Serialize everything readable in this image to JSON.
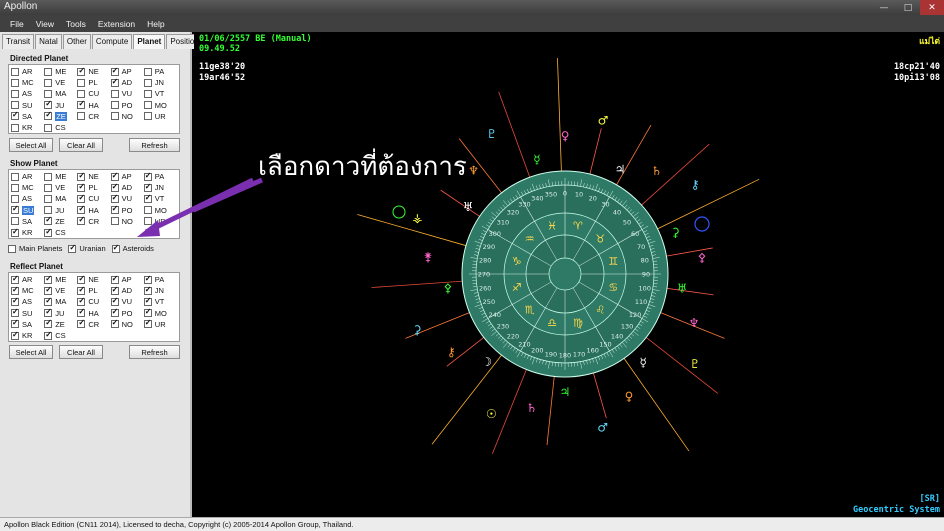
{
  "window": {
    "title": "Apollon",
    "controls": [
      "—",
      "□",
      "✕"
    ]
  },
  "menu": [
    "File",
    "View",
    "Tools",
    "Extension",
    "Help"
  ],
  "tabs": [
    {
      "label": "Transit",
      "active": false
    },
    {
      "label": "Natal",
      "active": false
    },
    {
      "label": "Other",
      "active": false
    },
    {
      "label": "Compute",
      "active": false
    },
    {
      "label": "Planet",
      "active": true
    },
    {
      "label": "Position",
      "active": false
    }
  ],
  "directed": {
    "label": "Directed Planet",
    "items": [
      {
        "code": "AR",
        "on": false
      },
      {
        "code": "ME",
        "on": false
      },
      {
        "code": "NE",
        "on": true
      },
      {
        "code": "AP",
        "on": true
      },
      {
        "code": "PA",
        "on": false
      },
      {
        "code": "MC",
        "on": false
      },
      {
        "code": "VE",
        "on": false
      },
      {
        "code": "PL",
        "on": false
      },
      {
        "code": "AD",
        "on": true
      },
      {
        "code": "JN",
        "on": false
      },
      {
        "code": "AS",
        "on": false
      },
      {
        "code": "MA",
        "on": false
      },
      {
        "code": "CU",
        "on": false
      },
      {
        "code": "VU",
        "on": false
      },
      {
        "code": "VT",
        "on": false
      },
      {
        "code": "SU",
        "on": false
      },
      {
        "code": "JU",
        "on": true
      },
      {
        "code": "HA",
        "on": true
      },
      {
        "code": "PO",
        "on": false
      },
      {
        "code": "MO",
        "on": false
      },
      {
        "code": "SA",
        "on": true
      },
      {
        "code": "ZE",
        "on": true,
        "highlight": true
      },
      {
        "code": "CR",
        "on": false
      },
      {
        "code": "NO",
        "on": false
      },
      {
        "code": "UR",
        "on": false
      },
      {
        "code": "KR",
        "on": false
      },
      {
        "code": "CS",
        "on": false
      }
    ],
    "select_all": "Select All",
    "clear_all": "Clear All",
    "refresh": "Refresh"
  },
  "show": {
    "label": "Show Planet",
    "items": [
      {
        "code": "AR",
        "on": false
      },
      {
        "code": "ME",
        "on": false
      },
      {
        "code": "NE",
        "on": true
      },
      {
        "code": "AP",
        "on": true
      },
      {
        "code": "PA",
        "on": true
      },
      {
        "code": "MC",
        "on": false
      },
      {
        "code": "VE",
        "on": false
      },
      {
        "code": "PL",
        "on": true
      },
      {
        "code": "AD",
        "on": true
      },
      {
        "code": "JN",
        "on": true
      },
      {
        "code": "AS",
        "on": false
      },
      {
        "code": "MA",
        "on": false
      },
      {
        "code": "CU",
        "on": true
      },
      {
        "code": "VU",
        "on": true
      },
      {
        "code": "VT",
        "on": true
      },
      {
        "code": "SU",
        "on": true,
        "highlight": true
      },
      {
        "code": "JU",
        "on": false
      },
      {
        "code": "HA",
        "on": true
      },
      {
        "code": "PO",
        "on": true
      },
      {
        "code": "MO",
        "on": false
      },
      {
        "code": "SA",
        "on": false
      },
      {
        "code": "ZE",
        "on": true
      },
      {
        "code": "CR",
        "on": true
      },
      {
        "code": "NO",
        "on": false
      },
      {
        "code": "UR",
        "on": false
      },
      {
        "code": "KR",
        "on": true
      },
      {
        "code": "CS",
        "on": true
      }
    ],
    "options": [
      {
        "label": "Main Planets",
        "on": false
      },
      {
        "label": "Uranian",
        "on": true
      },
      {
        "label": "Asteroids",
        "on": true
      }
    ]
  },
  "reflect": {
    "label": "Reflect Planet",
    "items": [
      {
        "code": "AR",
        "on": true
      },
      {
        "code": "ME",
        "on": true
      },
      {
        "code": "NE",
        "on": true
      },
      {
        "code": "AP",
        "on": true
      },
      {
        "code": "PA",
        "on": true
      },
      {
        "code": "MC",
        "on": true
      },
      {
        "code": "VE",
        "on": true
      },
      {
        "code": "PL",
        "on": true
      },
      {
        "code": "AD",
        "on": true
      },
      {
        "code": "JN",
        "on": true
      },
      {
        "code": "AS",
        "on": true
      },
      {
        "code": "MA",
        "on": true
      },
      {
        "code": "CU",
        "on": true
      },
      {
        "code": "VU",
        "on": true
      },
      {
        "code": "VT",
        "on": true
      },
      {
        "code": "SU",
        "on": true
      },
      {
        "code": "JU",
        "on": true
      },
      {
        "code": "HA",
        "on": true
      },
      {
        "code": "PO",
        "on": true
      },
      {
        "code": "MO",
        "on": true
      },
      {
        "code": "SA",
        "on": true
      },
      {
        "code": "ZE",
        "on": true
      },
      {
        "code": "CR",
        "on": true
      },
      {
        "code": "NO",
        "on": true
      },
      {
        "code": "UR",
        "on": true
      },
      {
        "code": "KR",
        "on": true
      },
      {
        "code": "CS",
        "on": true
      }
    ],
    "select_all": "Select All",
    "clear_all": "Clear All",
    "refresh": "Refresh"
  },
  "chart": {
    "date": "01/06/2557 BE (Manual)",
    "time": "09.49.52",
    "name": "แม่ไต่",
    "pos_left_1": "11ge38'20",
    "pos_left_2": "19ar46'52",
    "pos_right_1": "18cp21'40",
    "pos_right_2": "10pi13'08",
    "mode_tag": "[SR]",
    "system": "Geocentric System",
    "annotation": "เลือกดาวที่ต้องการ",
    "colors": {
      "green": "#33ff33",
      "white": "#ffffff",
      "wheel": "#2e7a66",
      "cyan": "#33ccff",
      "accent": "#7a2fb0"
    },
    "degree_labels": [
      "0",
      "10",
      "20",
      "30",
      "40",
      "50",
      "60",
      "70",
      "80",
      "90",
      "100",
      "110",
      "120",
      "130",
      "140",
      "150",
      "160",
      "170",
      "180",
      "190",
      "200",
      "210",
      "220",
      "230",
      "240",
      "250",
      "260",
      "270",
      "280",
      "290",
      "300",
      "310",
      "320",
      "330",
      "340",
      "350"
    ],
    "zodiac_glyphs": [
      "♈",
      "♉",
      "♊",
      "♋",
      "♌",
      "♍",
      "♎",
      "♏",
      "♐",
      "♑",
      "♒",
      "♓"
    ],
    "planet_glyphs": [
      "♅",
      "♆",
      "♇",
      "☿",
      "♀",
      "♂",
      "♃",
      "♄",
      "☉",
      "☽",
      "⚷",
      "⚳",
      "⚴",
      "⚵",
      "⚶",
      "♅",
      "♆",
      "♇",
      "☿",
      "♀",
      "♂",
      "♃",
      "♄",
      "⚷",
      "⚳",
      "⚴"
    ]
  },
  "status": "Apollon Black Edition (CN11 2014), Licensed to decha, Copyright (c) 2005-2014 Apollon Group, Thailand."
}
